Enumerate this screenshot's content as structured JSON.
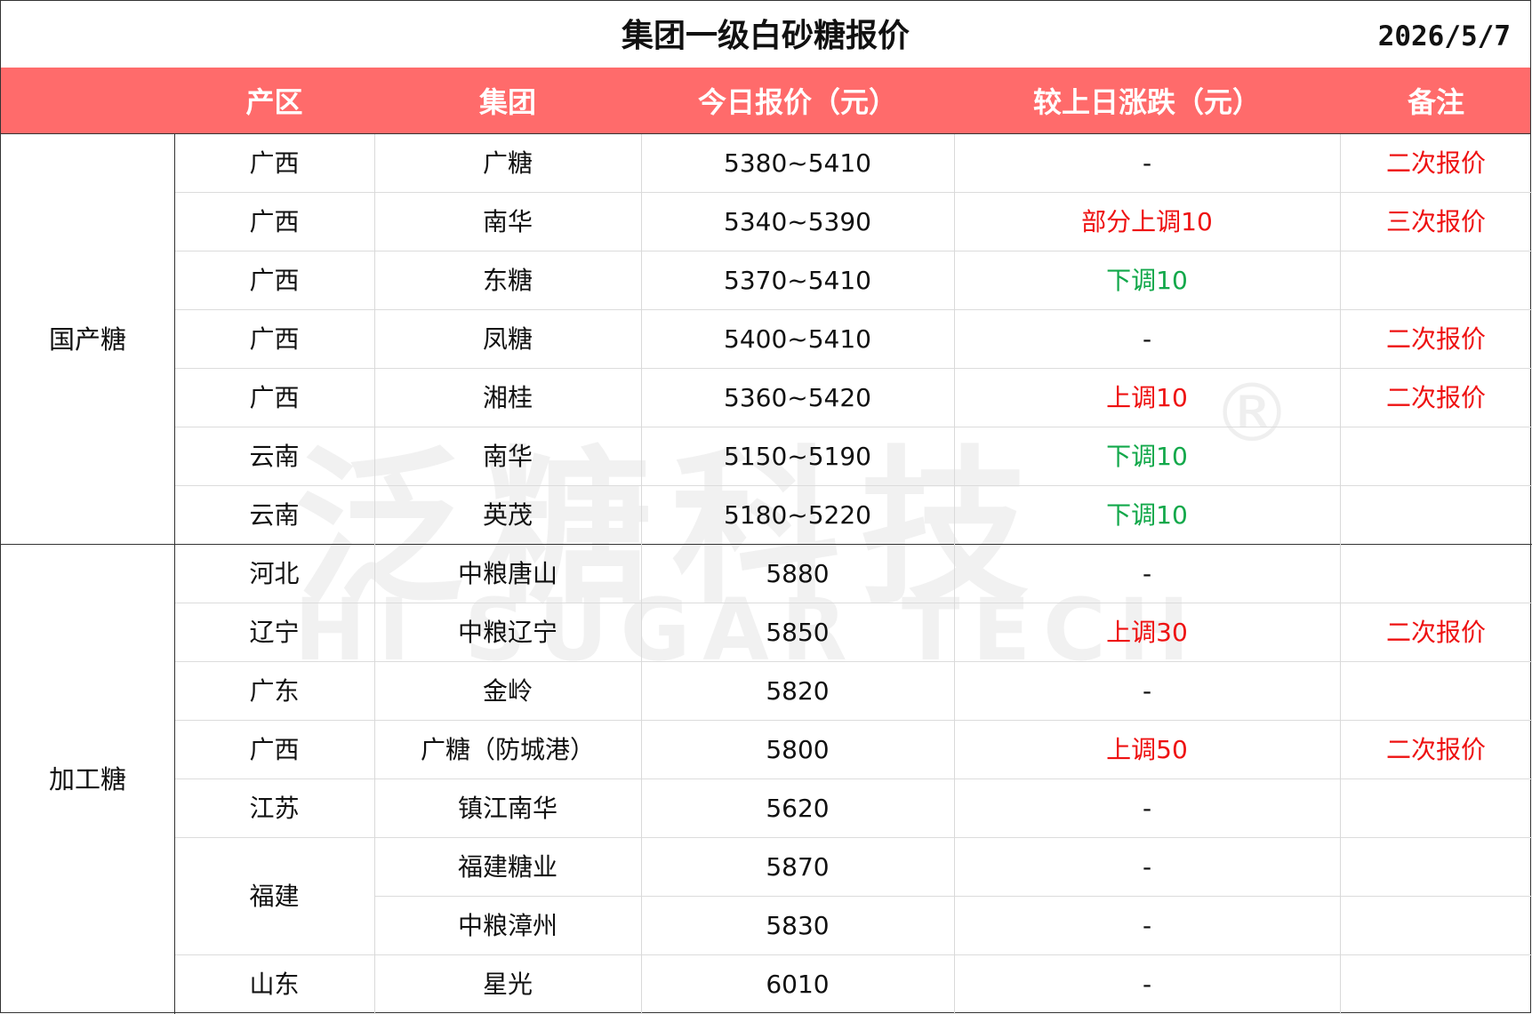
{
  "title": "集团一级白砂糖报价",
  "date": "2026/5/7",
  "columns": [
    "产区",
    "集团",
    "今日报价（元）",
    "较上日涨跌（元）",
    "备注"
  ],
  "groups": [
    {
      "name": "国产糖"
    },
    {
      "name": "加工糖"
    }
  ],
  "rows": [
    {
      "region": "广西",
      "company": "广糖",
      "price": "5380~5410",
      "change": "-",
      "note": "二次报价"
    },
    {
      "region": "广西",
      "company": "南华",
      "price": "5340~5390",
      "change": "部分上调10",
      "note": "三次报价"
    },
    {
      "region": "广西",
      "company": "东糖",
      "price": "5370~5410",
      "change": "下调10",
      "note": ""
    },
    {
      "region": "广西",
      "company": "凤糖",
      "price": "5400~5410",
      "change": "-",
      "note": "二次报价"
    },
    {
      "region": "广西",
      "company": "湘桂",
      "price": "5360~5420",
      "change": "上调10",
      "note": "二次报价"
    },
    {
      "region": "云南",
      "company": "南华",
      "price": "5150~5190",
      "change": "下调10",
      "note": ""
    },
    {
      "region": "云南",
      "company": "英茂",
      "price": "5180~5220",
      "change": "下调10",
      "note": ""
    },
    {
      "region": "河北",
      "company": "中粮唐山",
      "price": "5880",
      "change": "-",
      "note": ""
    },
    {
      "region": "辽宁",
      "company": "中粮辽宁",
      "price": "5850",
      "change": "上调30",
      "note": "二次报价"
    },
    {
      "region": "广东",
      "company": "金岭",
      "price": "5820",
      "change": "-",
      "note": ""
    },
    {
      "region": "广西",
      "company": "广糖（防城港）",
      "price": "5800",
      "change": "上调50",
      "note": "二次报价"
    },
    {
      "region": "江苏",
      "company": "镇江南华",
      "price": "5620",
      "change": "-",
      "note": ""
    },
    {
      "region": "福建",
      "company": "福建糖业",
      "price": "5870",
      "change": "-",
      "note": ""
    },
    {
      "region": "",
      "company": "中粮漳州",
      "price": "5830",
      "change": "-",
      "note": ""
    },
    {
      "region": "山东",
      "company": "星光",
      "price": "6010",
      "change": "-",
      "note": ""
    }
  ],
  "merged_region_fujian": "福建",
  "watermark": {
    "cn": "泛糖科技",
    "en": "HI SUGAR TECH",
    "reg": "®"
  },
  "colors": {
    "header_bg": "#ff6b6b",
    "up": "#ee1111",
    "down": "#12a84a"
  }
}
